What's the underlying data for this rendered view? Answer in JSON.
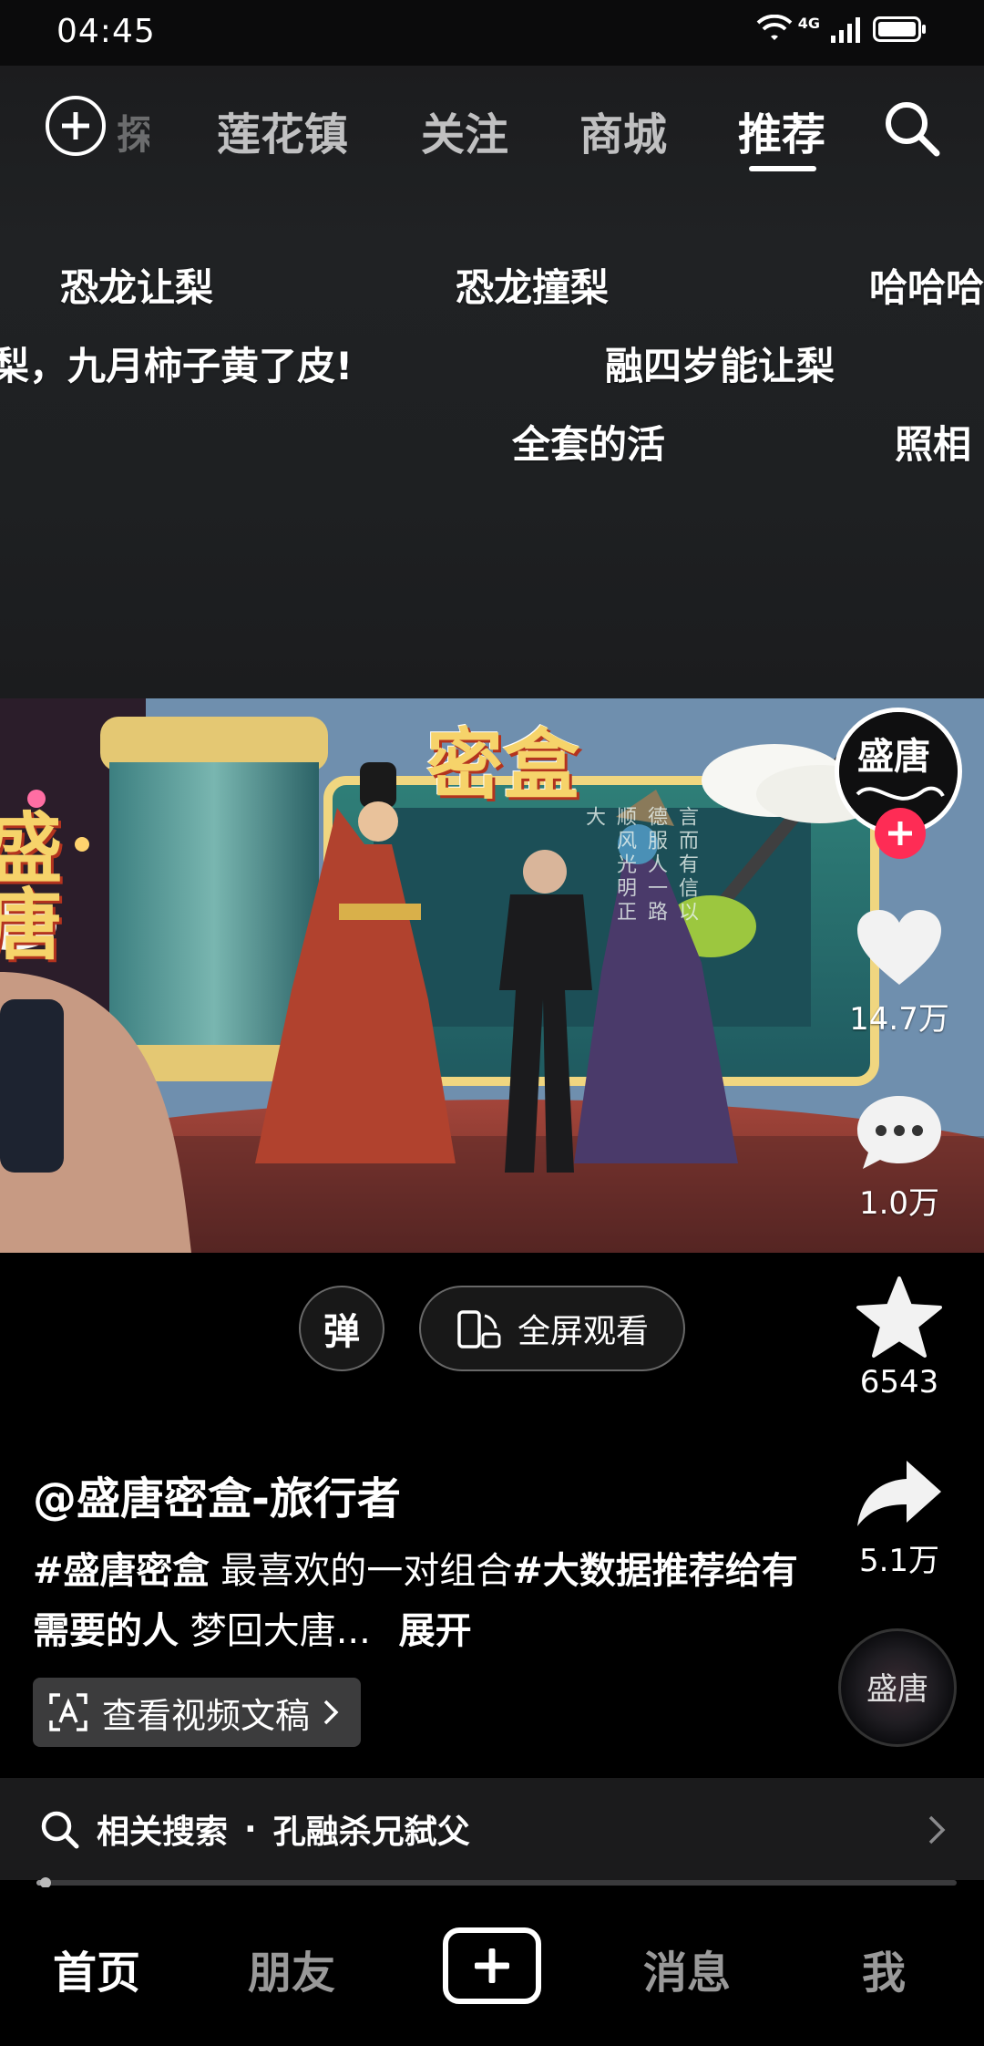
{
  "status_bar": {
    "time": "04:45",
    "network": "4G"
  },
  "top_nav": {
    "ghost_tab": "探索",
    "tabs": [
      {
        "label": "莲花镇"
      },
      {
        "label": "关注"
      },
      {
        "label": "商城"
      },
      {
        "label": "推荐",
        "active": true
      }
    ]
  },
  "danmaku": [
    "恐龙让梨",
    "恐龙撞梨",
    "哈哈哈",
    "梨，九月柿子黄了皮!",
    "融四岁能让梨",
    "全套的活",
    "照相"
  ],
  "video": {
    "sign_text": "密盒",
    "left_sign_text": "盛唐",
    "scroll_text": "言而有信以德服人一路顺风光明正大"
  },
  "overlay": {
    "danmaku_toggle": "弹",
    "fullscreen_label": "全屏观看"
  },
  "rail": {
    "avatar_text": "盛唐",
    "likes": "14.7万",
    "comments": "1.0万",
    "favorites": "6543",
    "shares": "5.1万",
    "music_disc_text": "盛唐"
  },
  "caption": {
    "author": "@盛唐密盒-旅行者",
    "tag1": "#盛唐密盒",
    "text1": " 最喜欢的一对组合",
    "tag2": "#大数据推荐给有需要的人",
    "text2": " 梦回大唐...",
    "expand": "展开",
    "transcript_label": "查看视频文稿"
  },
  "related": {
    "prefix": "相关搜索",
    "separator": "·",
    "query": "孔融杀兄弑父"
  },
  "playback": {
    "progress": 0.01
  },
  "bottom_nav": {
    "items": [
      {
        "label": "首页",
        "active": true
      },
      {
        "label": "朋友"
      },
      {
        "label": "消息"
      },
      {
        "label": "我"
      }
    ]
  },
  "colors": {
    "accent": "#fe2c55",
    "background": "#000000",
    "text": "#ffffff"
  }
}
